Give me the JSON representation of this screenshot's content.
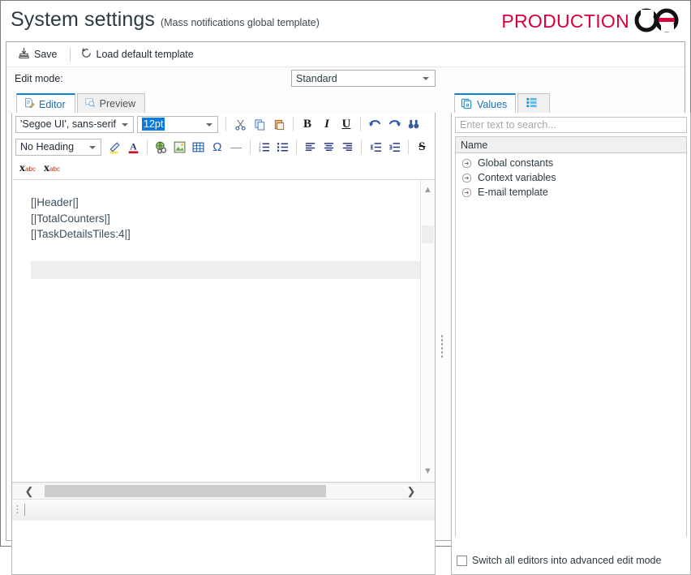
{
  "header": {
    "title": "System settings",
    "subtitle": "(Mass notifications global template)",
    "logo_text": "PRODUCTION",
    "logo_icon": "broken-chain-link-icon",
    "logo_color": "#d8003c"
  },
  "toolbar": {
    "save_label": "Save",
    "save_icon": "save-disk-icon",
    "load_default_label": "Load default template",
    "load_default_icon": "revert-arrow-icon"
  },
  "edit_mode": {
    "label": "Edit mode:",
    "selected": "Standard",
    "options": [
      "Standard"
    ]
  },
  "editor": {
    "tabs": [
      {
        "label": "Editor",
        "icon": "document-edit-icon",
        "active": true
      },
      {
        "label": "Preview",
        "icon": "preview-magnifier-icon",
        "active": false
      }
    ],
    "rte": {
      "font_family_value": "'Segoe UI', sans-serif",
      "font_size_value": "12pt",
      "heading_value": "No Heading",
      "row1_buttons": [
        {
          "name": "cut-icon",
          "glyph": "✂"
        },
        {
          "name": "copy-icon",
          "glyph": "❐"
        },
        {
          "name": "paste-icon",
          "glyph": "ὌB"
        },
        {
          "name": "bold-icon",
          "glyph": "B"
        },
        {
          "name": "italic-icon",
          "glyph": "I"
        },
        {
          "name": "underline-icon",
          "glyph": "U"
        },
        {
          "name": "undo-icon",
          "glyph": "↶"
        },
        {
          "name": "redo-icon",
          "glyph": "↷"
        },
        {
          "name": "find-icon",
          "glyph": "⚲"
        }
      ],
      "row2_buttons": [
        {
          "name": "highlight-color-icon",
          "glyph": "✎"
        },
        {
          "name": "font-color-icon",
          "glyph": "A"
        },
        {
          "name": "insert-link-icon",
          "glyph": "ἱ0"
        },
        {
          "name": "insert-image-icon",
          "glyph": "ὛC"
        },
        {
          "name": "insert-table-icon",
          "glyph": "⊞"
        },
        {
          "name": "special-character-icon",
          "glyph": "Ω"
        },
        {
          "name": "horizontal-rule-icon",
          "glyph": "—"
        },
        {
          "name": "numbered-list-icon",
          "glyph": "≣"
        },
        {
          "name": "bullet-list-icon",
          "glyph": "≣"
        },
        {
          "name": "align-left-icon",
          "glyph": "≡"
        },
        {
          "name": "align-center-icon",
          "glyph": "≡"
        },
        {
          "name": "align-right-icon",
          "glyph": "≡"
        },
        {
          "name": "decrease-indent-icon",
          "glyph": "⇤"
        },
        {
          "name": "increase-indent-icon",
          "glyph": "⇥"
        },
        {
          "name": "strikethrough-icon",
          "glyph": "S"
        }
      ],
      "row3_buttons": [
        {
          "name": "superscript-icon",
          "base": "x",
          "script": "abc"
        },
        {
          "name": "subscript-icon",
          "base": "x",
          "script": "abc"
        }
      ]
    },
    "content_lines": [
      "[|Header|]",
      "[|TotalCounters|]",
      "[|TaskDetailsTiles:4|]"
    ]
  },
  "values_panel": {
    "tabs": [
      {
        "label": "Values",
        "icon": "values-a-icon",
        "active": true
      },
      {
        "label": "",
        "icon": "properties-list-icon",
        "active": false
      }
    ],
    "search_placeholder": "Enter text to search...",
    "search_value": "",
    "grid_header": "Name",
    "tree_items": [
      {
        "label": "Global constants",
        "icon": "expand-arrow-icon"
      },
      {
        "label": "Context variables",
        "icon": "expand-arrow-icon"
      },
      {
        "label": "E-mail template",
        "icon": "expand-arrow-icon"
      }
    ],
    "advanced_checkbox": {
      "label": "Switch all editors into advanced edit mode",
      "checked": false
    }
  }
}
